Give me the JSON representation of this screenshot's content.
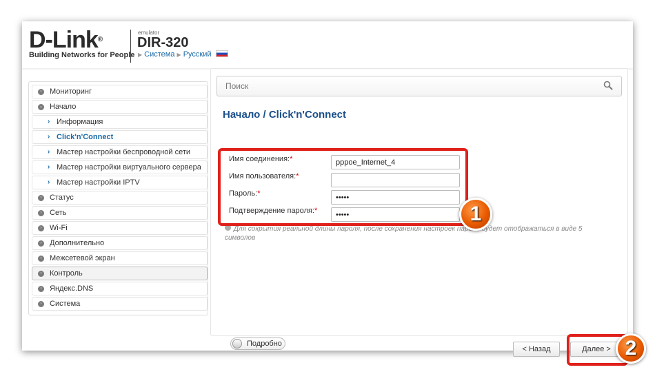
{
  "header": {
    "logo": "D-Link",
    "logo_mark": "®",
    "tagline": "Building Networks for People",
    "emulator_label": "emulator",
    "model": "DIR-320",
    "breadcrumb": [
      "Система",
      "Русский"
    ]
  },
  "search": {
    "placeholder": "Поиск"
  },
  "sidebar": {
    "items": [
      {
        "label": "Мониторинг"
      },
      {
        "label": "Начало"
      },
      {
        "label": "Информация"
      },
      {
        "label": "Click'n'Connect"
      },
      {
        "label": "Мастер настройки беспроводной сети"
      },
      {
        "label": "Мастер настройки виртуального сервера"
      },
      {
        "label": "Мастер настройки IPTV"
      },
      {
        "label": "Статус"
      },
      {
        "label": "Сеть"
      },
      {
        "label": "Wi-Fi"
      },
      {
        "label": "Дополнительно"
      },
      {
        "label": "Межсетевой экран"
      },
      {
        "label": "Контроль"
      },
      {
        "label": "Яндекс.DNS"
      },
      {
        "label": "Система"
      }
    ]
  },
  "page": {
    "title": "Начало /  Click'n'Connect"
  },
  "form": {
    "connection_name_label": "Имя соединения:",
    "connection_name_value": "pppoe_Internet_4",
    "username_label": "Имя пользователя:",
    "username_value": "",
    "password_label": "Пароль:",
    "password_value": "•••••",
    "confirm_label": "Подтверждение пароля:",
    "confirm_value": "•••••",
    "required_mark": "*"
  },
  "hint": {
    "text": "Для сокрытия реальной длины пароля, после сохранения настроек пароль будет отображаться в виде 5 символов"
  },
  "footer": {
    "details_toggle": "Подробно",
    "back_button": "< Назад",
    "next_button": "Далее >"
  },
  "annotations": {
    "badge1": "1",
    "badge2": "2"
  },
  "colors": {
    "accent": "#1b6aa8",
    "title": "#1b4f8a",
    "highlight": "#e0201a",
    "badge": "#e85a00"
  }
}
